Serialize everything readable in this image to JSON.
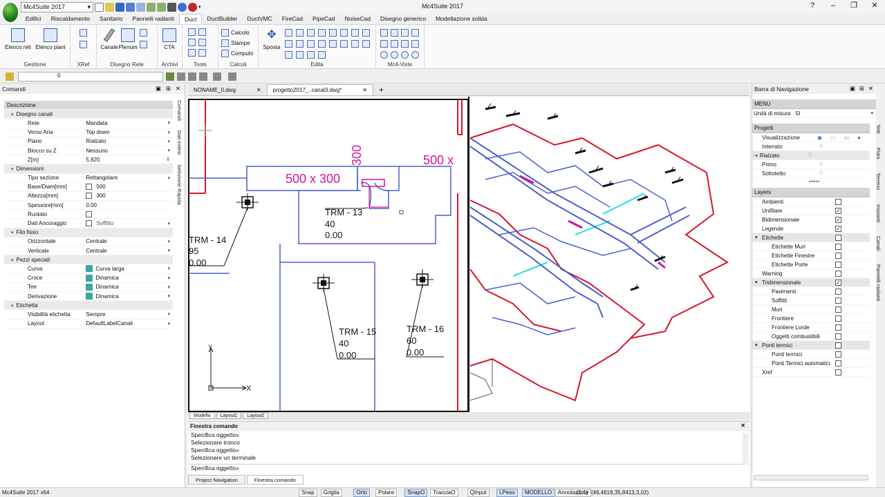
{
  "app": {
    "title": "Mc4Suite 2017",
    "workspace": "Mc4Suite 2017",
    "version": "Mc4Suite 2017 x64"
  },
  "ribbon": {
    "tabs": [
      "Edifici",
      "Riscaldamento",
      "Sanitario",
      "Pannelli radianti",
      "Duct",
      "DuctBuilder",
      "DuctVMC",
      "FireCad",
      "PipeCad",
      "NoiseCad",
      "Disegno generico",
      "Modellazione solida"
    ],
    "active_tab": "Duct",
    "groups": {
      "gestione": {
        "label": "Gestione",
        "btn1": "Elenco reti",
        "btn2": "Elenco piani"
      },
      "xref": {
        "label": "XRef"
      },
      "disegno": {
        "label": "Disegno Rete",
        "btn1": "Canale",
        "btn2": "Plenum"
      },
      "archivi": {
        "label": "Archivi",
        "btn1": "CTA"
      },
      "tools": {
        "label": "Tools"
      },
      "calcoli": {
        "label": "Calcoli",
        "items": [
          "Calcolo",
          "Stampe",
          "Computo"
        ]
      },
      "edita": {
        "label": "Edita",
        "btn1": "Sposta"
      },
      "viste": {
        "label": "Mc4-Viste"
      }
    }
  },
  "layer": {
    "current": "0"
  },
  "left_panel": {
    "title": "Comandi",
    "header": "Descrizione",
    "vtabs": [
      "Comandi",
      "Dati estesi",
      "Selezione Rapida"
    ],
    "rows": [
      {
        "type": "sec",
        "label": "Disegno canali"
      },
      {
        "label": "Rete",
        "value": "Mandata",
        "dd": true
      },
      {
        "label": "Verso Aria",
        "value": "Top down",
        "dd": true
      },
      {
        "label": "Piano",
        "value": "Rialzato",
        "dd": true
      },
      {
        "label": "Blocco su Z",
        "value": "Nessuno",
        "dd": true
      },
      {
        "label": "Z[m]",
        "value": "5.820",
        "spin": true
      },
      {
        "type": "sec",
        "label": "Dimensioni"
      },
      {
        "label": "Tipo sezione",
        "value": "Rettangolare",
        "dd": true
      },
      {
        "label": "Base/Diam[mm]",
        "value": "500",
        "check": true
      },
      {
        "label": "Altezza[mm]",
        "value": "300",
        "check": true
      },
      {
        "label": "Spessore[mm]",
        "value": "0.00"
      },
      {
        "label": "Ruotato",
        "value": "",
        "check": true
      },
      {
        "label": "Dati Ancoraggio",
        "value": "Soffitto",
        "check": true,
        "dd": true,
        "gray": true
      },
      {
        "type": "sec",
        "label": "Filo fisso"
      },
      {
        "label": "Orizzontale",
        "value": "Centrale",
        "dd": true
      },
      {
        "label": "Verticale",
        "value": "Centrale",
        "dd": true
      },
      {
        "type": "sec",
        "label": "Pezzi speciali"
      },
      {
        "label": "Curva",
        "value": "Curva larga",
        "dd": true,
        "icon": true
      },
      {
        "label": "Croce",
        "value": "Dinamica",
        "dd": true,
        "icon": true
      },
      {
        "label": "Tee",
        "value": "Dinamica",
        "dd": true,
        "icon": true
      },
      {
        "label": "Derivazione",
        "value": "Dinamica",
        "dd": true,
        "icon": true
      },
      {
        "type": "sec",
        "label": "Etichetta"
      },
      {
        "label": "Visibilità etichetta",
        "value": "Sempre",
        "dd": true
      },
      {
        "label": "Layout",
        "value": "DefaultLabelCanali",
        "dd": true
      }
    ]
  },
  "doc_tabs": [
    "NONAME_0.dwg",
    "progetto2017_..canal3.dwg*"
  ],
  "drawing": {
    "duct_label1": "500 x 300",
    "duct_label2": "500 x",
    "duct_label3": "300",
    "trm": [
      {
        "name": "TRM - 13",
        "v1": "40",
        "v2": "0.00"
      },
      {
        "name": "TRM - 14",
        "v1": "95",
        "v2": "0.00"
      },
      {
        "name": "TRM - 15",
        "v1": "40",
        "v2": "0.00"
      },
      {
        "name": "TRM - 16",
        "v1": "60",
        "v2": "0.00"
      }
    ],
    "axis_x": "X",
    "axis_y": "Y"
  },
  "layout_tabs": [
    "Modello",
    "Layout1",
    "Layout2"
  ],
  "command": {
    "title": "Finestra comando",
    "lines": [
      "Specifica oggetto»",
      "Selezionare tronco",
      "Specifica oggetto»",
      "Selezionare un  terminale"
    ],
    "prompt": "Specifica oggetto»",
    "tabs": [
      "Project Navigation",
      "Finestra comando"
    ]
  },
  "right_panel": {
    "title": "Barra di Navigazione",
    "menu": "MENU",
    "units_label": "Unità di misura",
    "units_value": "SI",
    "projects_title": "Progetti",
    "visual": "Visualizzazione",
    "floors": [
      "Interrato",
      "Rialzato",
      "Primo",
      "Sottotetto"
    ],
    "layers_title": "Layers",
    "layers": [
      {
        "label": "Ambienti",
        "checked": false,
        "ind": 1
      },
      {
        "label": "Unifilare",
        "checked": true,
        "ind": 1
      },
      {
        "label": "Bidimensionale",
        "checked": true,
        "ind": 1
      },
      {
        "label": "Legende",
        "checked": true,
        "ind": 1
      },
      {
        "label": "Etichette",
        "checked": false,
        "ind": 1,
        "sec": true
      },
      {
        "label": "Etichette Muri",
        "checked": false,
        "ind": 2
      },
      {
        "label": "Etichette Finestre",
        "checked": false,
        "ind": 2
      },
      {
        "label": "Etichette Porte",
        "checked": false,
        "ind": 2
      },
      {
        "label": "Warning",
        "checked": false,
        "ind": 1
      },
      {
        "label": "Tridimensionale",
        "checked": true,
        "ind": 1,
        "sec": true
      },
      {
        "label": "Pavimenti",
        "checked": false,
        "ind": 2
      },
      {
        "label": "Soffitti",
        "checked": false,
        "ind": 2
      },
      {
        "label": "Muri",
        "checked": false,
        "ind": 2
      },
      {
        "label": "Frontiere",
        "checked": false,
        "ind": 2
      },
      {
        "label": "Frontiere Lorde",
        "checked": false,
        "ind": 2
      },
      {
        "label": "Oggetti combustibili",
        "checked": false,
        "ind": 2
      },
      {
        "label": "Ponti termici",
        "checked": false,
        "ind": 1,
        "sec": true
      },
      {
        "label": "Ponti termici",
        "checked": false,
        "ind": 2
      },
      {
        "label": "Ponti Termici automatici",
        "checked": false,
        "ind": 2
      },
      {
        "label": "Xref",
        "checked": false,
        "ind": 1
      }
    ],
    "vtabs": [
      "Tetti",
      "Piani",
      "Terreno",
      "Impianti",
      "Canali",
      "Pannelli radianti"
    ]
  },
  "status": {
    "buttons": [
      "Snap",
      "Griglia",
      "Orto",
      "Polare",
      "SnapO",
      "TracciaO",
      "QInput",
      "LPeso",
      "MODELLO",
      "Annotazione"
    ],
    "on": [
      "Orto",
      "SnapO",
      "LPeso",
      "MODELLO"
    ],
    "scale": "(1:1)",
    "coords": "(46,4618,35,8413,3,02)"
  },
  "colors": {
    "wall": "#d8142c",
    "duct": "#4a5ecf",
    "label": "#d0149a",
    "cyan": "#1ae0e0"
  }
}
